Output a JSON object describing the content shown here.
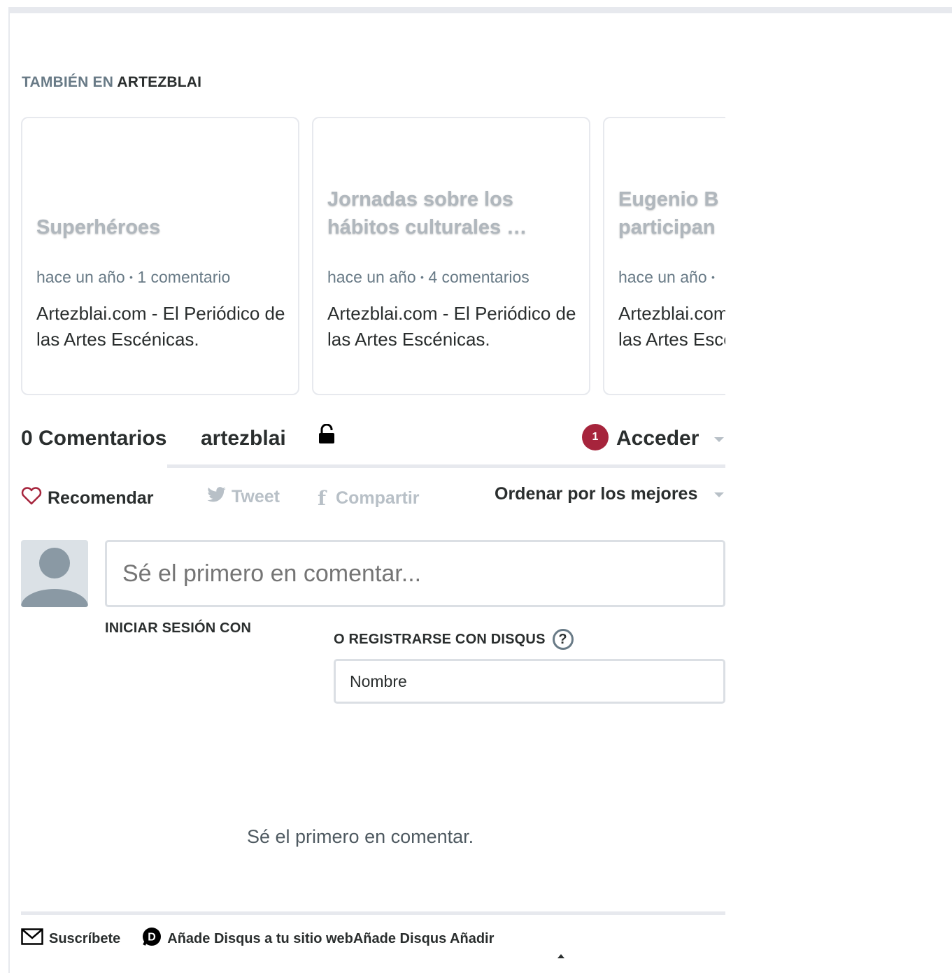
{
  "also_on": {
    "prefix": "TAMBIÉN EN",
    "site": "ARTEZBLAI"
  },
  "cards": [
    {
      "title": "Superhéroes",
      "time": "hace un año",
      "comments": "1 comentario",
      "description": "Artezblai.com - El Periódico de las Artes Escénicas."
    },
    {
      "title": "Jornadas sobre los hábitos culturales …",
      "time": "hace un año",
      "comments": "4 comentarios",
      "description": "Artezblai.com - El Periódico de las Artes Escénicas."
    },
    {
      "title": "Eugenio B participan",
      "time": "hace un año",
      "comments": "",
      "description": "Artezblai.com - El Periódico de las Artes Escénicas."
    }
  ],
  "nav": {
    "count": "0 Comentarios",
    "tab": "artezblai",
    "notifications": "1",
    "login": "Acceder"
  },
  "actions": {
    "recommend": "Recomendar",
    "tweet": "Tweet",
    "share": "Compartir",
    "sort": "Ordenar por los mejores"
  },
  "composer": {
    "placeholder": "Sé el primero en comentar..."
  },
  "auth": {
    "login_with": "INICIAR SESIÓN CON",
    "register": "O REGISTRARSE CON DISQUS",
    "help": "?",
    "name_placeholder": "Nombre"
  },
  "empty_message": "Sé el primero en comentar.",
  "footer": {
    "subscribe": "Suscríbete",
    "add_disqus": "Añade Disqus a tu sitio webAñade Disqus Añadir"
  },
  "colors": {
    "accent": "#a6243c",
    "muted": "#687a86",
    "text": "#2a2e2e"
  }
}
